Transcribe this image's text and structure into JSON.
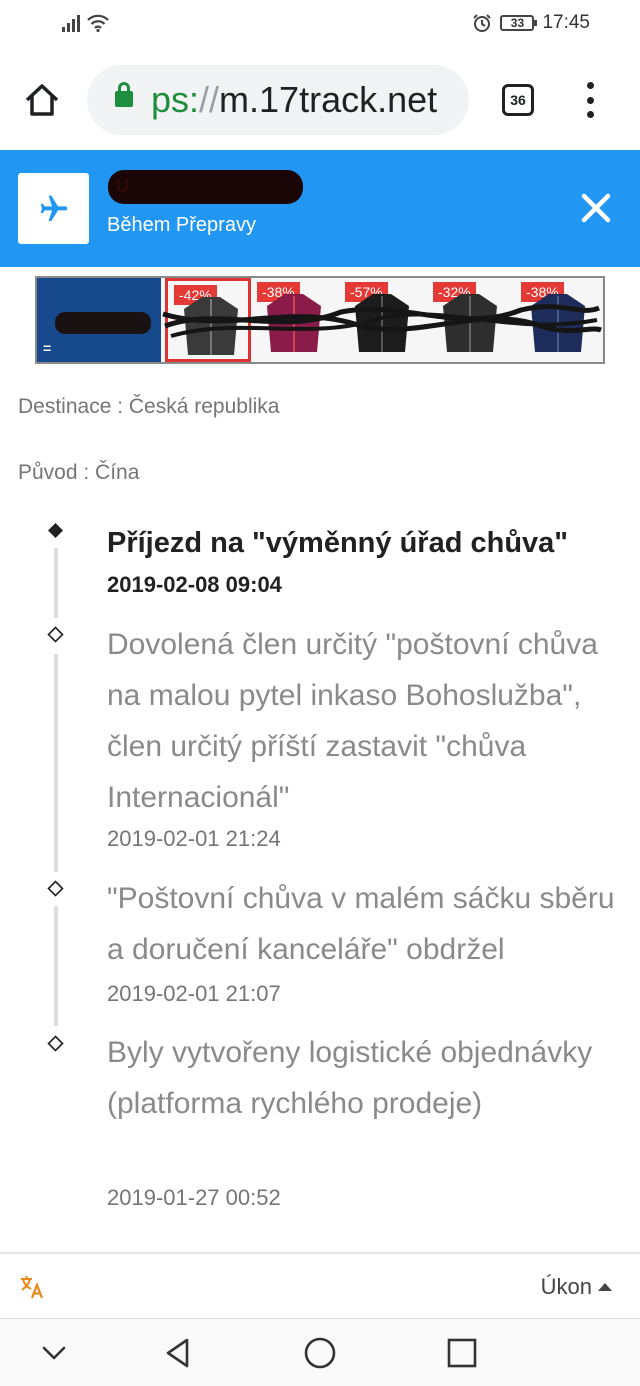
{
  "status_bar": {
    "battery": "33",
    "time": "17:45"
  },
  "browser": {
    "url_scheme": "ps:",
    "url_separator": "//",
    "url_host": "m.17track.net",
    "tab_count": "36"
  },
  "header": {
    "tracking_number": "U",
    "status": "Během Přepravy",
    "accent_color": "#2196f3"
  },
  "ad": {
    "logo_text": "=",
    "badges": [
      "-42%",
      "-38%",
      "-57%",
      "-32%",
      "-38%"
    ]
  },
  "info": {
    "destination": "Destinace : Česká republika",
    "origin": "Původ : Čína"
  },
  "events": [
    {
      "text": "Příjezd na \"výměnný úřad chůva\"",
      "time": "2019-02-08 09:04"
    },
    {
      "text": "Dovolená člen určitý \"poštovní chůva na malou pytel inkaso Bohoslužba\", člen určitý příští zastavit \"chůva Internacionál\"",
      "time": "2019-02-01 21:24"
    },
    {
      "text": "\"Poštovní chůva v malém sáčku sběru a doručení kanceláře\" obdržel",
      "time": "2019-02-01 21:07"
    },
    {
      "text": "Byly vytvořeny logistické objednávky (platforma rychlého prodeje)",
      "time": "2019-01-27 00:52"
    }
  ],
  "translate_bar": {
    "action_label": "Úkon"
  }
}
